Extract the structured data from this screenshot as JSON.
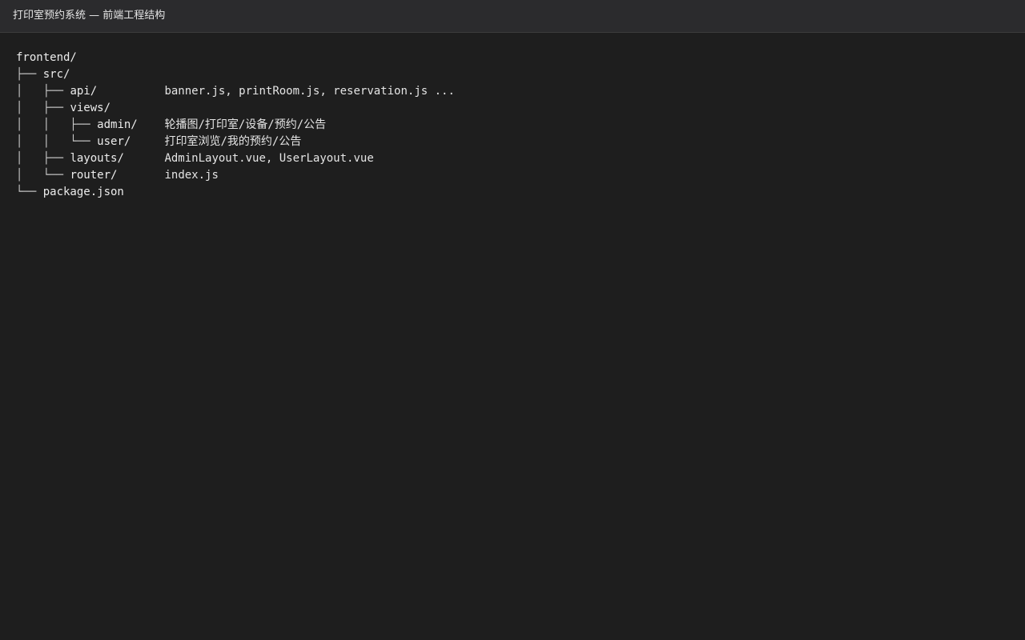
{
  "window": {
    "title": "打印室预约系统 — 前端工程结构"
  },
  "tree": {
    "lines": [
      {
        "prefix": "",
        "name": "frontend/",
        "note": ""
      },
      {
        "prefix": "├── ",
        "name": "src/",
        "note": ""
      },
      {
        "prefix": "│   ├── ",
        "name": "api/",
        "note": "banner.js, printRoom.js, reservation.js ..."
      },
      {
        "prefix": "│   ├── ",
        "name": "views/",
        "note": ""
      },
      {
        "prefix": "│   │   ├── ",
        "name": "admin/",
        "note": "轮播图/打印室/设备/预约/公告"
      },
      {
        "prefix": "│   │   └── ",
        "name": "user/",
        "note": "打印室浏览/我的预约/公告"
      },
      {
        "prefix": "│   ├── ",
        "name": "layouts/",
        "note": "AdminLayout.vue, UserLayout.vue"
      },
      {
        "prefix": "│   └── ",
        "name": "router/",
        "note": "index.js"
      },
      {
        "prefix": "└── ",
        "name": "package.json",
        "note": ""
      }
    ]
  }
}
